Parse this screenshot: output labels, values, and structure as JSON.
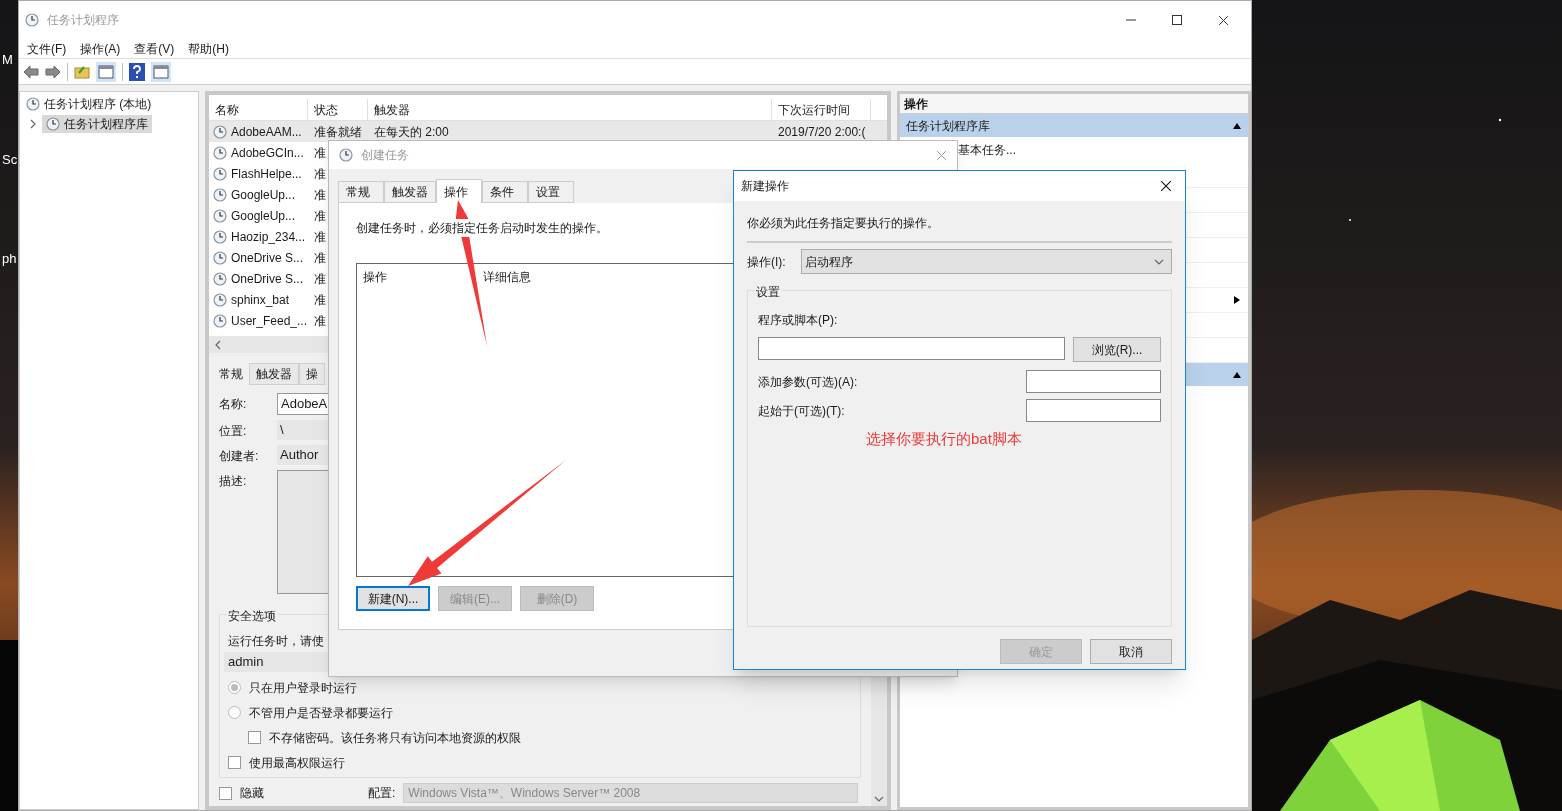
{
  "desktop": {
    "icon_labels": [
      "M",
      "Sc",
      "ph"
    ]
  },
  "main_window": {
    "title": "任务计划程序",
    "menu": [
      "文件(F)",
      "操作(A)",
      "查看(V)",
      "帮助(H)"
    ],
    "tree": [
      {
        "label": "任务计划程序 (本地)",
        "selected": false,
        "children": [
          {
            "label": "任务计划程序库",
            "selected": true,
            "expanded": false
          }
        ]
      }
    ],
    "task_list": {
      "columns": [
        "名称",
        "状态",
        "触发器",
        "下次运行时间"
      ],
      "rows": [
        {
          "name": "AdobeAAM...",
          "status": "准备就绪",
          "trigger": "在每天的 2:00",
          "next_run": "2019/7/20 2:00:(",
          "selected": true
        },
        {
          "name": "AdobeGCIn...",
          "status": "准",
          "selected": false
        },
        {
          "name": "FlashHelpe...",
          "status": "准",
          "selected": false
        },
        {
          "name": "GoogleUp...",
          "status": "准",
          "selected": false
        },
        {
          "name": "GoogleUp...",
          "status": "准",
          "selected": false
        },
        {
          "name": "Haozip_234...",
          "status": "准",
          "selected": false
        },
        {
          "name": "OneDrive S...",
          "status": "准",
          "selected": false
        },
        {
          "name": "OneDrive S...",
          "status": "准",
          "selected": false
        },
        {
          "name": "sphinx_bat",
          "status": "准",
          "selected": false
        },
        {
          "name": "User_Feed_...",
          "status": "准",
          "selected": false
        }
      ]
    },
    "details": {
      "tabs": [
        {
          "label": "常规",
          "selected": true
        },
        {
          "label": "触发器",
          "selected": false
        },
        {
          "label": "操",
          "selected": false
        }
      ],
      "fields": [
        {
          "label": "名称:",
          "value": "AdobeA",
          "kind": "input"
        },
        {
          "label": "位置:",
          "value": "\\",
          "kind": "text"
        },
        {
          "label": "创建者:",
          "value": "Author",
          "kind": "text"
        },
        {
          "label": "描述:",
          "kind": "area"
        }
      ],
      "security": {
        "title": "安全选项",
        "prompt": "运行任务时，请使",
        "account": "admin",
        "options": [
          {
            "kind": "radio",
            "label": "只在用户登录时运行",
            "selected": true
          },
          {
            "kind": "radio",
            "label": "不管用户是否登录都要运行",
            "selected": false
          },
          {
            "kind": "subcheck",
            "label": "不存储密码。该任务将只有访问本地资源的权限",
            "checked": false
          },
          {
            "kind": "check",
            "label": "使用最高权限运行",
            "checked": false
          }
        ]
      },
      "hidden": {
        "label": "隐藏",
        "checked": false
      },
      "config": {
        "label": "配置:",
        "value": "Windows Vista™、Windows Server™ 2008"
      }
    },
    "actions_pane": {
      "header": "操作",
      "sections": [
        {
          "title": "任务计划程序库",
          "expanded": true,
          "items": [
            "基本任务..."
          ]
        },
        {
          "expanded": true
        }
      ]
    }
  },
  "create_task": {
    "title": "创建任务",
    "tabs": [
      {
        "label": "常规",
        "selected": false
      },
      {
        "label": "触发器",
        "selected": false
      },
      {
        "label": "操作",
        "selected": true
      },
      {
        "label": "条件",
        "selected": false
      },
      {
        "label": "设置",
        "selected": false
      }
    ],
    "description": "创建任务时，必须指定任务启动时发生的操作。",
    "columns": [
      "操作",
      "详细信息"
    ],
    "buttons": [
      {
        "label": "新建(N)...",
        "disabled": false
      },
      {
        "label": "编辑(E)...",
        "disabled": true
      },
      {
        "label": "删除(D)",
        "disabled": true
      }
    ]
  },
  "new_action": {
    "title": "新建操作",
    "instruction": "你必须为此任务指定要执行的操作。",
    "action_label": "操作(I):",
    "action_value": "启动程序",
    "group": "设置",
    "program_label": "程序或脚本(P):",
    "browse": "浏览(R)...",
    "args_label": "添加参数(可选)(A):",
    "start_label": "起始于(可选)(T):",
    "annotation": "选择你要执行的bat脚本",
    "ok": {
      "label": "确定",
      "disabled": true
    },
    "cancel": {
      "label": "取消",
      "disabled": false
    }
  }
}
